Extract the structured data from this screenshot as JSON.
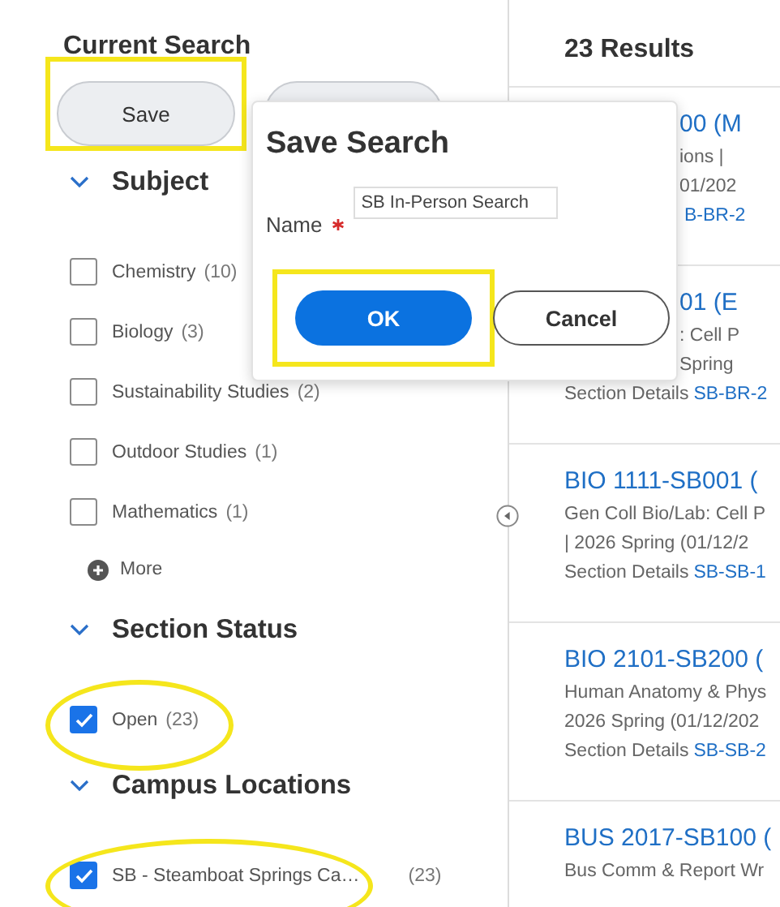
{
  "filters": {
    "title": "Current Search",
    "buttons": [
      {
        "kind": "labelled",
        "label": "Save",
        "highlighted": true
      },
      {
        "kind": "covered"
      }
    ],
    "groups": [
      {
        "title": "Subject",
        "expanded": true,
        "options": [
          {
            "label": "Chemistry",
            "count": "(10)",
            "checked": false,
            "highlighted": false
          },
          {
            "label": "Biology",
            "count": "(3)",
            "checked": false,
            "highlighted": false
          },
          {
            "label": "Sustainability Studies",
            "count": "(2)",
            "checked": false,
            "highlighted": false
          },
          {
            "label": "Outdoor Studies",
            "count": "(1)",
            "checked": false,
            "highlighted": false
          },
          {
            "label": "Mathematics",
            "count": "(1)",
            "checked": false,
            "highlighted": false
          }
        ],
        "more": "More"
      },
      {
        "title": "Section Status",
        "expanded": true,
        "options": [
          {
            "label": "Open",
            "count": "(23)",
            "checked": true,
            "highlighted": true
          }
        ]
      },
      {
        "title": "Campus Locations",
        "expanded": true,
        "options": [
          {
            "label": "SB - Steamboat Springs Ca…",
            "count": "(23)",
            "checked": true,
            "highlighted": true
          }
        ]
      }
    ]
  },
  "results": {
    "title": "23 Results",
    "items": [
      {
        "title": "00 (M",
        "covered": true,
        "lines": [
          {
            "text": "ions  |",
            "covered": true
          },
          {
            "text": "01/202",
            "covered": true
          },
          {
            "link": "B-BR-2",
            "covered": true
          }
        ]
      },
      {
        "title": "01 (E",
        "covered": true,
        "lines": [
          {
            "text": ": Cell P",
            "covered": true
          },
          {
            "text": "Spring",
            "covered": true
          },
          {
            "text": "Section Details",
            "link": "SB-BR-2",
            "covered": false
          }
        ]
      },
      {
        "title": "BIO 1111-SB001 (",
        "covered": false,
        "lines": [
          {
            "text": "Gen Coll Bio/Lab: Cell P",
            "covered": false
          },
          {
            "text": "|  2026 Spring (01/12/2",
            "covered": false
          },
          {
            "text": "Section Details",
            "link": "SB-SB-1",
            "covered": false
          }
        ]
      },
      {
        "title": "BIO 2101-SB200 (",
        "covered": false,
        "lines": [
          {
            "text": "Human Anatomy & Phys",
            "covered": false
          },
          {
            "text": "2026 Spring (01/12/202",
            "covered": false
          },
          {
            "text": "Section Details",
            "link": "SB-SB-2",
            "covered": false
          }
        ]
      },
      {
        "title": "BUS 2017-SB100 (",
        "covered": false,
        "lines": [
          {
            "text": "Bus Comm & Report Wr",
            "covered": false
          }
        ]
      }
    ]
  },
  "dialog": {
    "title": "Save Search",
    "field": {
      "label": "Name",
      "required": true,
      "value": "SB In-Person Search"
    },
    "buttons": [
      {
        "kind": "primary",
        "label": "OK",
        "highlighted": true
      },
      {
        "kind": "secondary",
        "label": "Cancel",
        "highlighted": false
      }
    ]
  }
}
